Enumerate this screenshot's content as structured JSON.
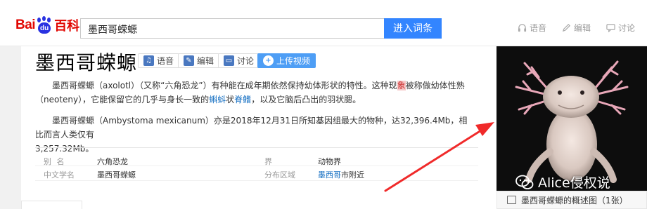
{
  "logo": {
    "bai": "Bai",
    "du": "du",
    "ke": "百科"
  },
  "search": {
    "value": "墨西哥蝾螈",
    "button": "进入词条"
  },
  "top_actions": [
    {
      "label": "语音",
      "icon": "headphones-icon"
    },
    {
      "label": "编辑",
      "icon": "pencil-icon"
    },
    {
      "label": "讨论",
      "icon": "chat-icon"
    }
  ],
  "article": {
    "title": "墨西哥蝾螈",
    "chips": [
      {
        "label": "语音",
        "icon": "headphones-icon"
      },
      {
        "label": "编辑",
        "icon": "pencil-icon"
      },
      {
        "label": "讨论",
        "icon": "chat-icon"
      },
      {
        "label": "上传视频",
        "icon": "plus-icon"
      }
    ],
    "para1": {
      "line1_a": "墨西哥蝾螈（axolotl）（又称“六角恐龙”）有种能在成年期依然保持幼体形状的特性。这种现",
      "line1_hl": "象",
      "line1_b": "被称做幼体性熟",
      "line2_a": "（neoteny），它能保留它的几乎与身长一致的",
      "line2_link1": "蝌蚪",
      "line2_b": "状",
      "line2_link2": "脊鳍",
      "line2_c": "，以及它脑后凸出的羽状腮。"
    },
    "para2": {
      "line1": "墨西哥蝾螈（Ambystoma mexicanum）亦是2018年12月31日所知基因组最大的物种，达32,396.4Mb，相比而言人类仅有",
      "line2": "3,257.32Mb。"
    },
    "info": [
      {
        "label": "别    名",
        "value": "六角恐龙",
        "label2": "界",
        "value2": "动物界"
      },
      {
        "label": "中文学名",
        "value": "墨西哥蝾螈",
        "label2": "分布区域",
        "value2_link": "墨西哥",
        "value2_rest": "市附近"
      }
    ]
  },
  "photo": {
    "watermark": "Alice侵权说",
    "caption": "墨西哥蝾螈的概述图（1张）"
  },
  "colors": {
    "brand_red": "#e10601",
    "brand_blue": "#2932e1",
    "button_blue": "#3385ff",
    "link": "#136ec2",
    "arrow": "#f02a2a"
  }
}
